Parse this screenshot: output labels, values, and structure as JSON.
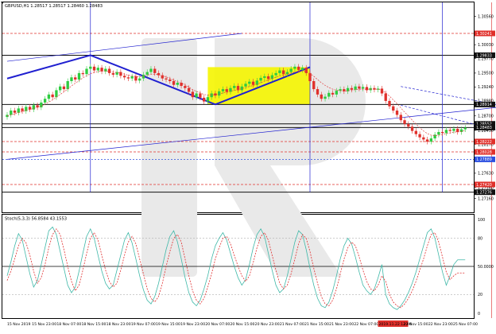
{
  "header": {
    "symbol_text": "GBPUSD,H1  1.28517 1.28517 1.28460 1.28483"
  },
  "stoch_header": {
    "text": "Stoch(5,3,3) 56.8584 43.1553"
  },
  "colors": {
    "background": "#ffffff",
    "bull_candle": "#2ecc40",
    "bear_candle": "#e0302b",
    "blue_line": "#2020d0",
    "red_line": "#e04040",
    "yellow_zone": "#f5f500",
    "stoch_main": "#3fb8a8",
    "stoch_signal": "#e03030",
    "price_label_black": "#111111",
    "price_label_red": "#e0302b",
    "price_label_blue": "#2b4fe0",
    "watermark": "#e8e8e8"
  },
  "chart_data": [
    {
      "type": "candlestick",
      "symbol": "GBPUSD",
      "timeframe": "H1",
      "ohlc_current": {
        "open": 1.28517,
        "high": 1.28517,
        "low": 1.2846,
        "close": 1.28483
      },
      "ylim": [
        1.269,
        1.3082
      ],
      "y_ticks": [
        1.3082,
        1.3056,
        1.3003,
        1.2977,
        1.295,
        1.2924,
        1.2898,
        1.287,
        1.2843,
        1.2817,
        1.279,
        1.2763,
        1.2736,
        1.2716,
        1.269
      ],
      "y_tick_labels": [
        "1.30820",
        "1.30560",
        "1.30030",
        "1.29770",
        "1.29500",
        "1.29240",
        "1.28980",
        "1.28700",
        "1.28430",
        "1.28170",
        "1.27900",
        "1.27630",
        "1.27360",
        "1.27160",
        "1.26900"
      ],
      "x_tick_labels": [
        "15 Nov 2019",
        "15 Nov 23:00",
        "18 Nov 07:00",
        "18 Nov 15:00",
        "18 Nov 23:00",
        "19 Nov 07:00",
        "19 Nov 15:00",
        "19 Nov 23:00",
        "20 Nov 07:00",
        "20 Nov 15:00",
        "20 Nov 23:00",
        "21 Nov 07:00",
        "21 Nov 15:00",
        "21 Nov 23:00",
        "22 Nov 07:00",
        "2019.11.22 12:00",
        "22 Nov 15:00",
        "22 Nov 23:00",
        "25 Nov 07:00"
      ],
      "highlighted_time": "2019.11.22 12:00",
      "price_labels": [
        {
          "text": "1.30241",
          "color": "red"
        },
        {
          "text": "1.29833",
          "color": "black"
        },
        {
          "text": "1.28914",
          "color": "black"
        },
        {
          "text": "1.28552",
          "color": "black"
        },
        {
          "text": "1.28483",
          "color": "black"
        },
        {
          "text": "1.28222",
          "color": "red"
        },
        {
          "text": "1.28028",
          "color": "red"
        },
        {
          "text": "1.27889",
          "color": "blue"
        },
        {
          "text": "1.27420",
          "color": "red"
        },
        {
          "text": "1.27276",
          "color": "black"
        }
      ],
      "yellow_zones": [
        {
          "x0": 53,
          "x1": 80,
          "y0": 1.29611,
          "y1": 1.28914
        },
        {
          "x0": 154,
          "x1": 166,
          "y0": 1.28552,
          "y1": 1.2817
        }
      ],
      "closes": [
        1.2872,
        1.288,
        1.2876,
        1.2884,
        1.2879,
        1.2887,
        1.2882,
        1.289,
        1.2886,
        1.2895,
        1.2902,
        1.291,
        1.2905,
        1.2918,
        1.2925,
        1.292,
        1.2935,
        1.2942,
        1.2938,
        1.295,
        1.2948,
        1.2958,
        1.2962,
        1.2955,
        1.296,
        1.2953,
        1.2958,
        1.295,
        1.2947,
        1.2952,
        1.2945,
        1.2942,
        1.294,
        1.2944,
        1.2936,
        1.294,
        1.2947,
        1.2952,
        1.2958,
        1.295,
        1.2946,
        1.294,
        1.2938,
        1.2935,
        1.2928,
        1.2932,
        1.2926,
        1.2922,
        1.2915,
        1.2905,
        1.2912,
        1.2904,
        1.2897,
        1.2905,
        1.2912,
        1.2908,
        1.2916,
        1.292,
        1.2915,
        1.2922,
        1.2926,
        1.2918,
        1.2925,
        1.293,
        1.2934,
        1.2928,
        1.2936,
        1.2941,
        1.2944,
        1.2939,
        1.2946,
        1.295,
        1.2955,
        1.2948,
        1.2952,
        1.2958,
        1.2962,
        1.2956,
        1.296,
        1.295,
        1.2935,
        1.292,
        1.291,
        1.2902,
        1.2906,
        1.2913,
        1.291,
        1.2917,
        1.292,
        1.2916,
        1.2922,
        1.2919,
        1.2925,
        1.2921,
        1.2924,
        1.2918,
        1.2922,
        1.2919,
        1.2921,
        1.2912,
        1.2898,
        1.2888,
        1.288,
        1.2872,
        1.2862,
        1.2855,
        1.285,
        1.2842,
        1.2836,
        1.283,
        1.2826,
        1.2822,
        1.2828,
        1.2835,
        1.284,
        1.2838,
        1.2844,
        1.2842,
        1.2846,
        1.284,
        1.2845,
        1.2848
      ],
      "ma_values": [
        1.287,
        1.2872,
        1.2874,
        1.2876,
        1.2878,
        1.288,
        1.2882,
        1.2884,
        1.2886,
        1.2888,
        1.2892,
        1.2896,
        1.29,
        1.2905,
        1.291,
        1.2915,
        1.292,
        1.2926,
        1.2931,
        1.2936,
        1.2941,
        1.2945,
        1.2949,
        1.2951,
        1.2953,
        1.2954,
        1.2954,
        1.2953,
        1.2952,
        1.2951,
        1.295,
        1.2948,
        1.2946,
        1.2945,
        1.2944,
        1.2943,
        1.2944,
        1.2946,
        1.2948,
        1.2948,
        1.2947,
        1.2945,
        1.2943,
        1.294,
        1.2937,
        1.2934,
        1.2931,
        1.2928,
        1.2924,
        1.2919,
        1.2916,
        1.2913,
        1.291,
        1.2909,
        1.2909,
        1.291,
        1.2911,
        1.2913,
        1.2914,
        1.2916,
        1.2918,
        1.2919,
        1.2921,
        1.2923,
        1.2925,
        1.2927,
        1.2929,
        1.2932,
        1.2935,
        1.2937,
        1.294,
        1.2942,
        1.2945,
        1.2946,
        1.2948,
        1.295,
        1.2952,
        1.2953,
        1.2954,
        1.2953,
        1.2949,
        1.2944,
        1.2938,
        1.2932,
        1.2927,
        1.2923,
        1.292,
        1.2918,
        1.2917,
        1.2916,
        1.2917,
        1.2918,
        1.2919,
        1.292,
        1.292,
        1.292,
        1.292,
        1.292,
        1.292,
        1.2918,
        1.2913,
        1.2907,
        1.29,
        1.2893,
        1.2885,
        1.2877,
        1.287,
        1.2862,
        1.2855,
        1.2848,
        1.2842,
        1.2837,
        1.2834,
        1.2833,
        1.2834,
        1.2835,
        1.2837,
        1.2838,
        1.284,
        1.284,
        1.2841,
        1.2843
      ],
      "trend_lines": [
        {
          "name": "wave-1",
          "from": [
            0,
            1.29398
          ],
          "to": [
            22,
            1.29833
          ]
        },
        {
          "name": "wave-2",
          "from": [
            22,
            1.29833
          ],
          "to": [
            55,
            1.28914
          ]
        },
        {
          "name": "wave-3",
          "from": [
            55,
            1.28914
          ],
          "to": [
            80,
            1.29611
          ]
        },
        {
          "name": "upper-channel",
          "from": [
            0,
            1.2972
          ],
          "to": [
            62,
            1.30241
          ]
        },
        {
          "name": "rising-channel",
          "from": [
            0,
            1.27889
          ],
          "to": [
            175,
            1.292
          ]
        },
        {
          "name": "descending-channel-upper",
          "from": [
            104,
            1.2925
          ],
          "to": [
            175,
            1.283
          ]
        },
        {
          "name": "descending-channel-lower",
          "from": [
            104,
            1.289
          ],
          "to": [
            175,
            1.276
          ]
        },
        {
          "name": "forecast-down",
          "from": [
            156,
            1.2842
          ],
          "to": [
            166,
            1.27889
          ]
        },
        {
          "name": "forecast-up",
          "from": [
            166,
            1.27889
          ],
          "to": [
            172,
            1.28552
          ]
        }
      ]
    },
    {
      "type": "line",
      "indicator": "Stoch(5,3,3)",
      "main_value": 56.8584,
      "signal_value": 43.1553,
      "ylim": [
        0,
        100
      ],
      "y_ticks": [
        0,
        20,
        50,
        80,
        100
      ],
      "y_tick_labels": [
        "0",
        "20",
        "50.0000",
        "80",
        "100"
      ],
      "series": [
        {
          "values": [
            40,
            55,
            72,
            85,
            78,
            60,
            42,
            28,
            35,
            52,
            70,
            88,
            92,
            84,
            66,
            48,
            30,
            22,
            28,
            45,
            64,
            82,
            90,
            80,
            62,
            45,
            32,
            26,
            30,
            46,
            62,
            78,
            86,
            75,
            58,
            40,
            25,
            14,
            10,
            18,
            32,
            50,
            68,
            82,
            88,
            76,
            58,
            38,
            22,
            12,
            8,
            14,
            26,
            40,
            58,
            72,
            80,
            86,
            78,
            64,
            50,
            38,
            30,
            36,
            52,
            70,
            84,
            90,
            82,
            64,
            46,
            30,
            22,
            26,
            40,
            58,
            76,
            88,
            84,
            68,
            48,
            30,
            16,
            8,
            6,
            12,
            24,
            40,
            58,
            72,
            80,
            74,
            60,
            44,
            30,
            24,
            20,
            26,
            38,
            52,
            20,
            10,
            6,
            4,
            8,
            14,
            22,
            32,
            44,
            58,
            72,
            86,
            90,
            80,
            62,
            44,
            30,
            40,
            52,
            57,
            57,
            57
          ]
        },
        {
          "values": [
            35,
            45,
            58,
            72,
            80,
            75,
            62,
            45,
            32,
            38,
            52,
            70,
            84,
            90,
            84,
            68,
            50,
            34,
            24,
            30,
            46,
            64,
            80,
            86,
            78,
            62,
            46,
            34,
            28,
            32,
            46,
            62,
            76,
            82,
            74,
            58,
            42,
            26,
            16,
            12,
            18,
            32,
            50,
            66,
            80,
            84,
            76,
            58,
            40,
            24,
            14,
            10,
            16,
            28,
            42,
            58,
            70,
            80,
            82,
            74,
            62,
            50,
            40,
            34,
            40,
            54,
            70,
            82,
            86,
            78,
            62,
            46,
            32,
            26,
            30,
            42,
            58,
            74,
            84,
            80,
            66,
            48,
            32,
            18,
            10,
            8,
            14,
            26,
            42,
            58,
            70,
            76,
            72,
            60,
            46,
            34,
            26,
            24,
            30,
            40,
            34,
            20,
            12,
            8,
            6,
            10,
            16,
            24,
            34,
            46,
            58,
            72,
            84,
            86,
            76,
            60,
            44,
            36,
            40,
            43,
            43,
            43
          ]
        }
      ]
    }
  ]
}
